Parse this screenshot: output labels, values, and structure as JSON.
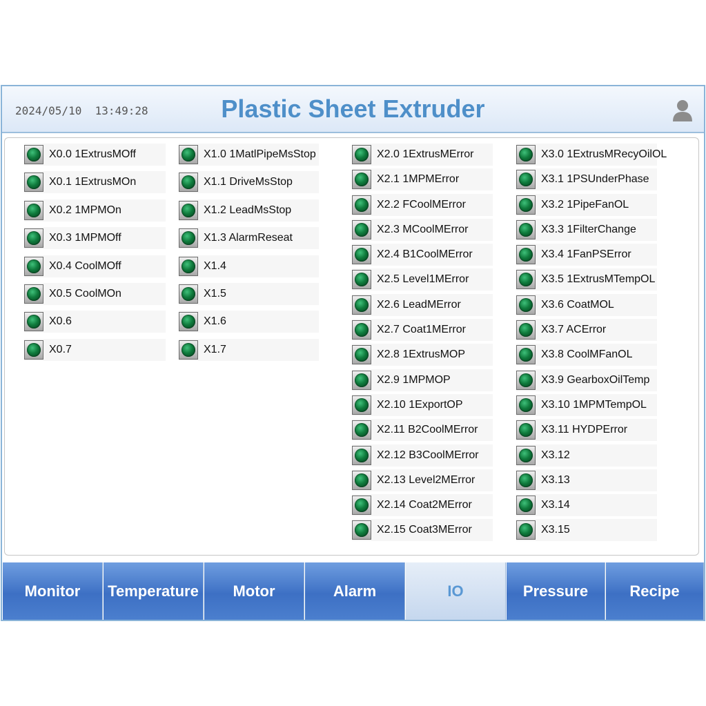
{
  "header": {
    "datetime": "2024/05/10  13:49:28",
    "title": "Plastic Sheet Extruder"
  },
  "io": {
    "x0": [
      "X0.0 1ExtrusMOff",
      "X0.1 1ExtrusMOn",
      "X0.2 1MPMOn",
      "X0.3 1MPMOff",
      "X0.4 CoolMOff",
      "X0.5 CoolMOn",
      "X0.6",
      "X0.7"
    ],
    "x1": [
      "X1.0 1MatlPipeMsStop",
      "X1.1 DriveMsStop",
      "X1.2 LeadMsStop",
      "X1.3 AlarmReseat",
      "X1.4",
      "X1.5",
      "X1.6",
      "X1.7"
    ],
    "x2": [
      "X2.0 1ExtrusMError",
      "X2.1 1MPMError",
      "X2.2 FCoolMError",
      "X2.3 MCoolMError",
      "X2.4 B1CoolMError",
      "X2.5 Level1MError",
      "X2.6 LeadMError",
      "X2.7 Coat1MError",
      "X2.8 1ExtrusMOP",
      "X2.9 1MPMOP",
      "X2.10 1ExportOP",
      "X2.11 B2CoolMError",
      "X2.12 B3CoolMError",
      "X2.13 Level2MError",
      "X2.14 Coat2MError",
      "X2.15 Coat3MError"
    ],
    "x3": [
      "X3.0 1ExtrusMRecyOilOL",
      "X3.1 1PSUnderPhase",
      "X3.2 1PipeFanOL",
      "X3.3 1FilterChange",
      "X3.4 1FanPSError",
      "X3.5 1ExtrusMTempOL",
      "X3.6 CoatMOL",
      "X3.7 ACError",
      "X3.8 CoolMFanOL",
      "X3.9 GearboxOilTemp",
      "X3.10 1MPMTempOL",
      "X3.11 HYDPError",
      "X3.12",
      "X3.13",
      "X3.14",
      "X3.15"
    ],
    "lamp_color": "#0f7a3c"
  },
  "tabs": [
    {
      "label": "Monitor"
    },
    {
      "label": "Temperature"
    },
    {
      "label": "Motor"
    },
    {
      "label": "Alarm"
    },
    {
      "label": "IO",
      "active": true
    },
    {
      "label": "Pressure"
    },
    {
      "label": "Recipe"
    }
  ],
  "icons": {
    "user": "user-icon",
    "lamp": "status-lamp-icon"
  }
}
